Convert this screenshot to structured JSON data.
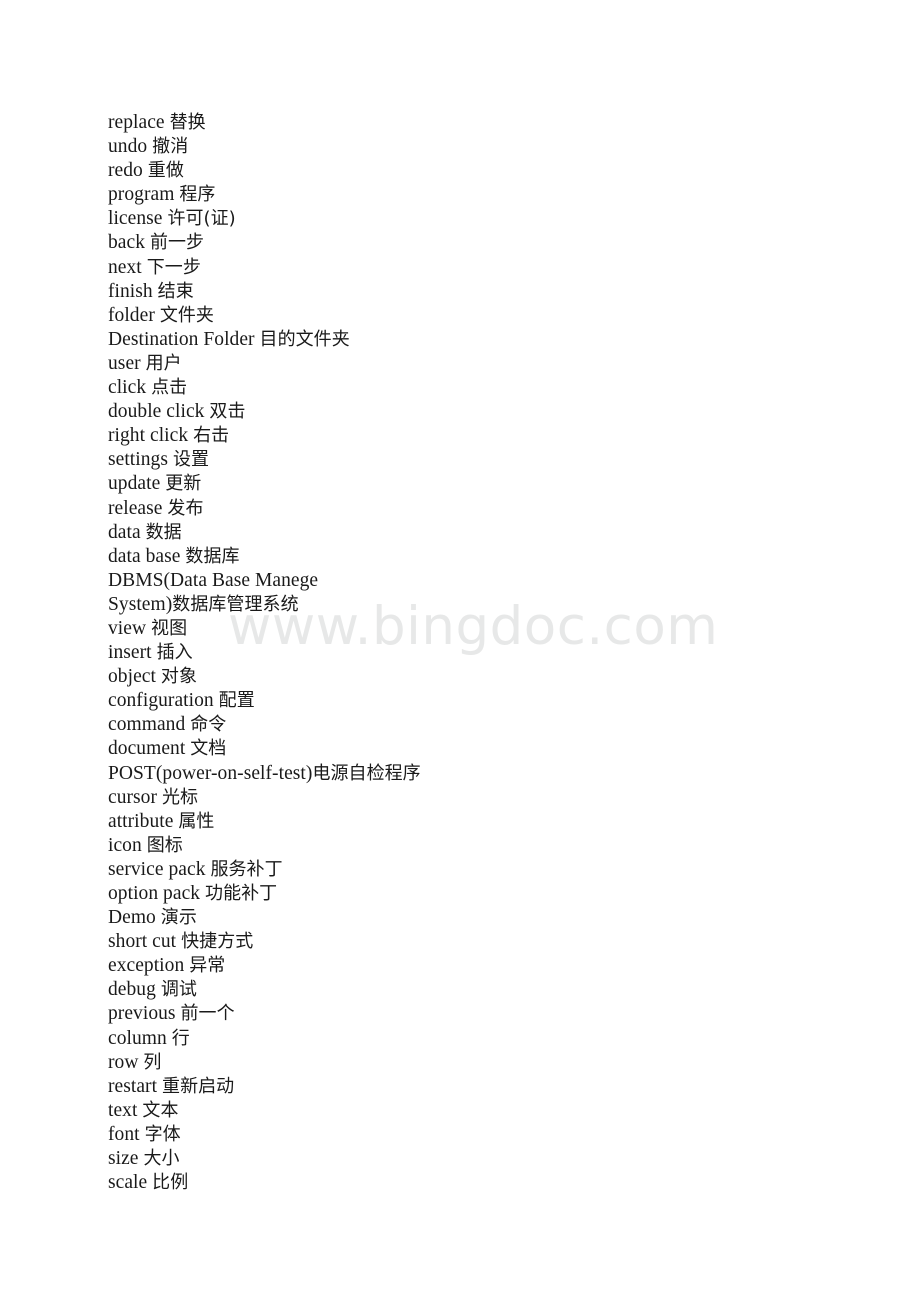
{
  "document": {
    "type": "glossary",
    "background_color": "#ffffff",
    "text_color": "#1a1a1a",
    "watermark": {
      "text": "www.bingdoc.com",
      "color": "#e7e8e8"
    },
    "entries": [
      {
        "term": "replace",
        "translation": "替换"
      },
      {
        "term": "undo",
        "translation": "撤消"
      },
      {
        "term": "redo",
        "translation": "重做"
      },
      {
        "term": "program",
        "translation": "程序"
      },
      {
        "term": "license",
        "translation": "许可(证)"
      },
      {
        "term": "back",
        "translation": "前一步"
      },
      {
        "term": "next",
        "translation": "下一步"
      },
      {
        "term": "finish",
        "translation": "结束"
      },
      {
        "term": "folder",
        "translation": "文件夹"
      },
      {
        "term": "Destination Folder",
        "translation": "目的文件夹"
      },
      {
        "term": "user",
        "translation": "用户"
      },
      {
        "term": "click",
        "translation": "点击"
      },
      {
        "term": "double click",
        "translation": "双击"
      },
      {
        "term": "right click",
        "translation": "右击"
      },
      {
        "term": "settings",
        "translation": "设置"
      },
      {
        "term": "update",
        "translation": "更新"
      },
      {
        "term": "release",
        "translation": "发布"
      },
      {
        "term": "data",
        "translation": "数据"
      },
      {
        "term": "data base",
        "translation": "数据库"
      },
      {
        "term": "DBMS(Data Base Manege",
        "translation": ""
      },
      {
        "term": "System)",
        "translation": "数据库管理系统",
        "nospace": true
      },
      {
        "term": "view",
        "translation": "视图"
      },
      {
        "term": "insert",
        "translation": "插入"
      },
      {
        "term": "object",
        "translation": "对象"
      },
      {
        "term": "configuration",
        "translation": "配置"
      },
      {
        "term": "command",
        "translation": "命令"
      },
      {
        "term": "document",
        "translation": "文档"
      },
      {
        "term": "POST(power-on-self-test)",
        "translation": "电源自检程序",
        "nospace": true
      },
      {
        "term": "cursor",
        "translation": "光标"
      },
      {
        "term": "attribute",
        "translation": "属性"
      },
      {
        "term": "icon",
        "translation": "图标"
      },
      {
        "term": "service pack",
        "translation": "服务补丁"
      },
      {
        "term": "option pack",
        "translation": "功能补丁"
      },
      {
        "term": "Demo",
        "translation": "演示"
      },
      {
        "term": "short cut",
        "translation": "快捷方式"
      },
      {
        "term": "exception",
        "translation": "异常"
      },
      {
        "term": "debug",
        "translation": "调试"
      },
      {
        "term": "previous",
        "translation": "前一个"
      },
      {
        "term": "column",
        "translation": "行"
      },
      {
        "term": "row",
        "translation": "列"
      },
      {
        "term": "restart",
        "translation": "重新启动"
      },
      {
        "term": "text",
        "translation": "文本"
      },
      {
        "term": "font",
        "translation": "字体"
      },
      {
        "term": "size",
        "translation": "大小"
      },
      {
        "term": "scale",
        "translation": "比例"
      }
    ]
  }
}
